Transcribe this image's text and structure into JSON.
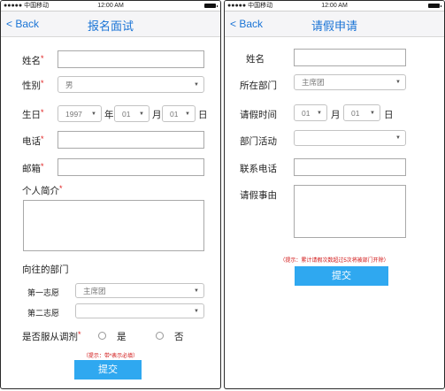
{
  "status_bar": {
    "carrier": "●●●●● 中国移动",
    "time": "12:00 AM"
  },
  "left": {
    "nav": {
      "back": "< Back",
      "title": "报名面试"
    },
    "name_label": "姓名",
    "gender_label": "性别",
    "gender_value": "男",
    "birthday_label": "生日",
    "birth_year": "1997",
    "year_unit": "年",
    "birth_month": "01",
    "month_unit": "月",
    "birth_day": "01",
    "day_unit": "日",
    "phone_label": "电话",
    "email_label": "邮箱",
    "intro_label": "个人简介",
    "dept_section": "向往的部门",
    "first_choice_label": "第一志愿",
    "first_choice_value": "主席团",
    "second_choice_label": "第二志愿",
    "second_choice_value": "",
    "adjust_label": "是否服从调剂",
    "adjust_yes": "是",
    "adjust_no": "否",
    "hint": "（提示：带*表示必填）",
    "submit": "提交",
    "required_mark": "*"
  },
  "right": {
    "nav": {
      "back": "< Back",
      "title": "请假申请"
    },
    "name_label": "姓名",
    "dept_label": "所在部门",
    "dept_value": "主席团",
    "leave_time_label": "请假时间",
    "month_value": "01",
    "month_unit": "月",
    "day_value": "01",
    "day_unit": "日",
    "activity_label": "部门活动",
    "activity_value": "",
    "contact_label": "联系电话",
    "reason_label": "请假事由",
    "hint": "（提示：累计请假次数超过5次将被部门开除）",
    "submit": "提交"
  }
}
